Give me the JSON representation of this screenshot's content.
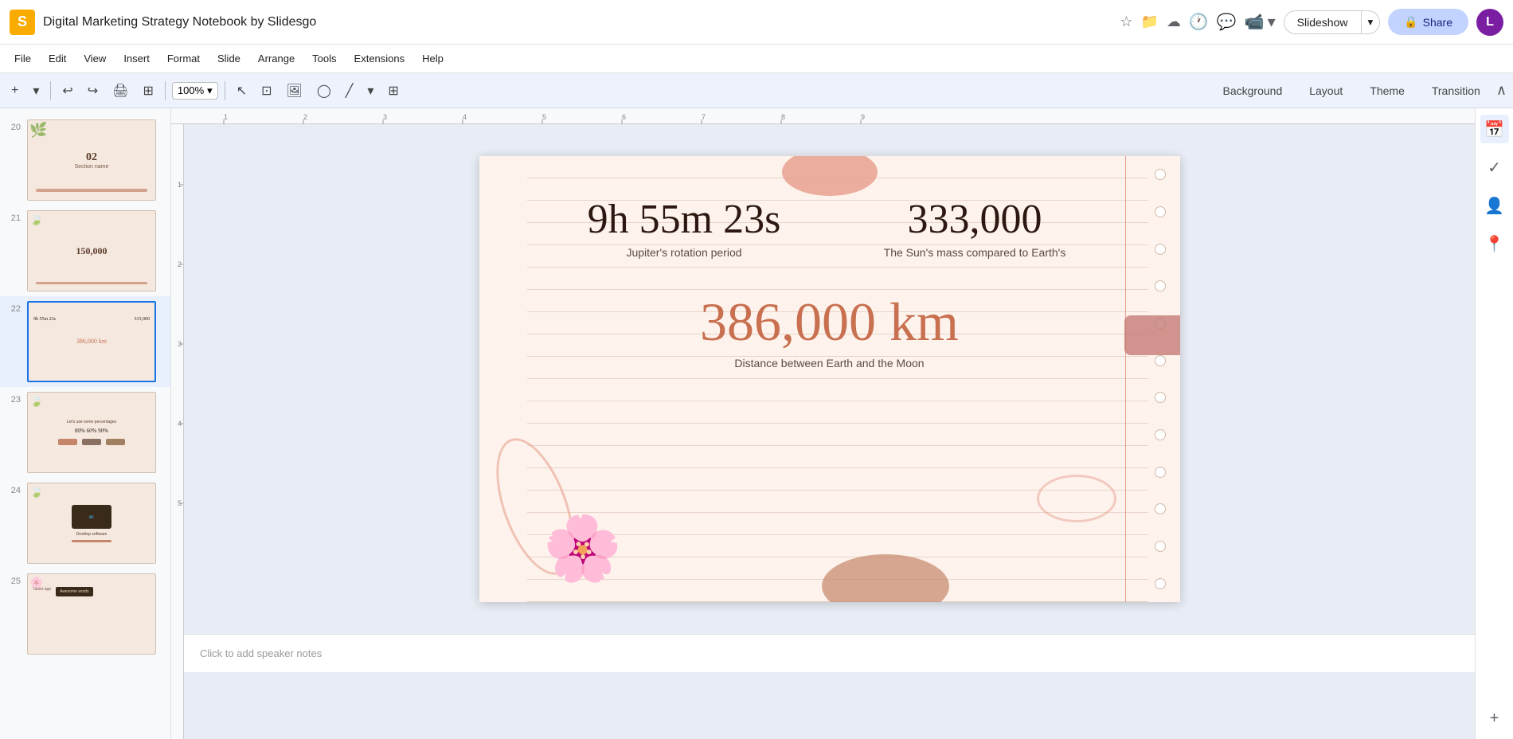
{
  "app": {
    "title": "Digital Marketing Strategy Notebook by Slidesgo",
    "logo_letter": "S"
  },
  "title_bar": {
    "history_icon": "🕐",
    "comment_icon": "💬",
    "meet_icon": "📹",
    "meet_label": "▾",
    "slideshow_label": "Slideshow",
    "slideshow_arrow": "▾",
    "share_label": "Share",
    "share_icon": "🔒",
    "avatar_letter": "L",
    "star_icon": "☆",
    "folder_icon": "📁",
    "cloud_icon": "☁"
  },
  "menu": {
    "items": [
      "File",
      "Edit",
      "View",
      "Insert",
      "Format",
      "Slide",
      "Arrange",
      "Tools",
      "Extensions",
      "Help"
    ]
  },
  "toolbar": {
    "add_icon": "+",
    "add_arrow": "▾",
    "undo_icon": "↩",
    "redo_icon": "↪",
    "print_icon": "🖨",
    "options_icon": "⊞",
    "zoom_value": "100%",
    "zoom_arrow": "▾",
    "cursor_icon": "↖",
    "select_icon": "⊡",
    "image_icon": "🖼",
    "shape_icon": "◯",
    "line_icon": "╱",
    "line_arrow": "▾",
    "text_icon": "⊞",
    "background_label": "Background",
    "layout_label": "Layout",
    "theme_label": "Theme",
    "transition_label": "Transition",
    "collapse_icon": "∧"
  },
  "slides": [
    {
      "number": "20",
      "label": "section-name-slide",
      "active": false,
      "thumb_text1": "02",
      "thumb_text2": "Section name",
      "thumb_color": "#f5e8df"
    },
    {
      "number": "21",
      "label": "number-slide",
      "active": false,
      "thumb_text1": "150,000",
      "thumb_color": "#f5e8df"
    },
    {
      "number": "22",
      "label": "stats-slide",
      "active": true,
      "thumb_text1": "9h 55m 23s",
      "thumb_text2": "333,000",
      "thumb_text3": "386,000 km",
      "thumb_color": "#f5e8df"
    },
    {
      "number": "23",
      "label": "percentages-slide",
      "active": false,
      "thumb_text1": "Let's use some percentages",
      "thumb_text2": "80%  60%  90%",
      "thumb_color": "#f5e8df"
    },
    {
      "number": "24",
      "label": "desktop-software-slide",
      "active": false,
      "thumb_text1": "Desktop software",
      "thumb_color": "#f5e8df"
    },
    {
      "number": "25",
      "label": "tablet-app-slide",
      "active": false,
      "thumb_text1": "Tablet app",
      "thumb_text2": "Awesome words",
      "thumb_color": "#f5e8df"
    }
  ],
  "slide_content": {
    "stat1_value": "9h 55m 23s",
    "stat1_label": "Jupiter's rotation period",
    "stat2_value": "333,000",
    "stat2_label": "The Sun's mass compared to Earth's",
    "stat3_value": "386,000 km",
    "stat3_label": "Distance between Earth and the Moon"
  },
  "speaker_notes": {
    "placeholder": "Click to add speaker notes"
  },
  "right_sidebar": {
    "icons": [
      {
        "name": "calendar-icon",
        "glyph": "📅",
        "active": true
      },
      {
        "name": "check-icon",
        "glyph": "✓",
        "active": false
      },
      {
        "name": "person-icon",
        "glyph": "👤",
        "active": false
      },
      {
        "name": "map-icon",
        "glyph": "📍",
        "active": false
      }
    ]
  },
  "colors": {
    "accent": "#e8a090",
    "brand": "#f9ab00",
    "active_blue": "#1a73e8",
    "slide_bg": "#f5e8df",
    "stat_color": "#c87050"
  }
}
